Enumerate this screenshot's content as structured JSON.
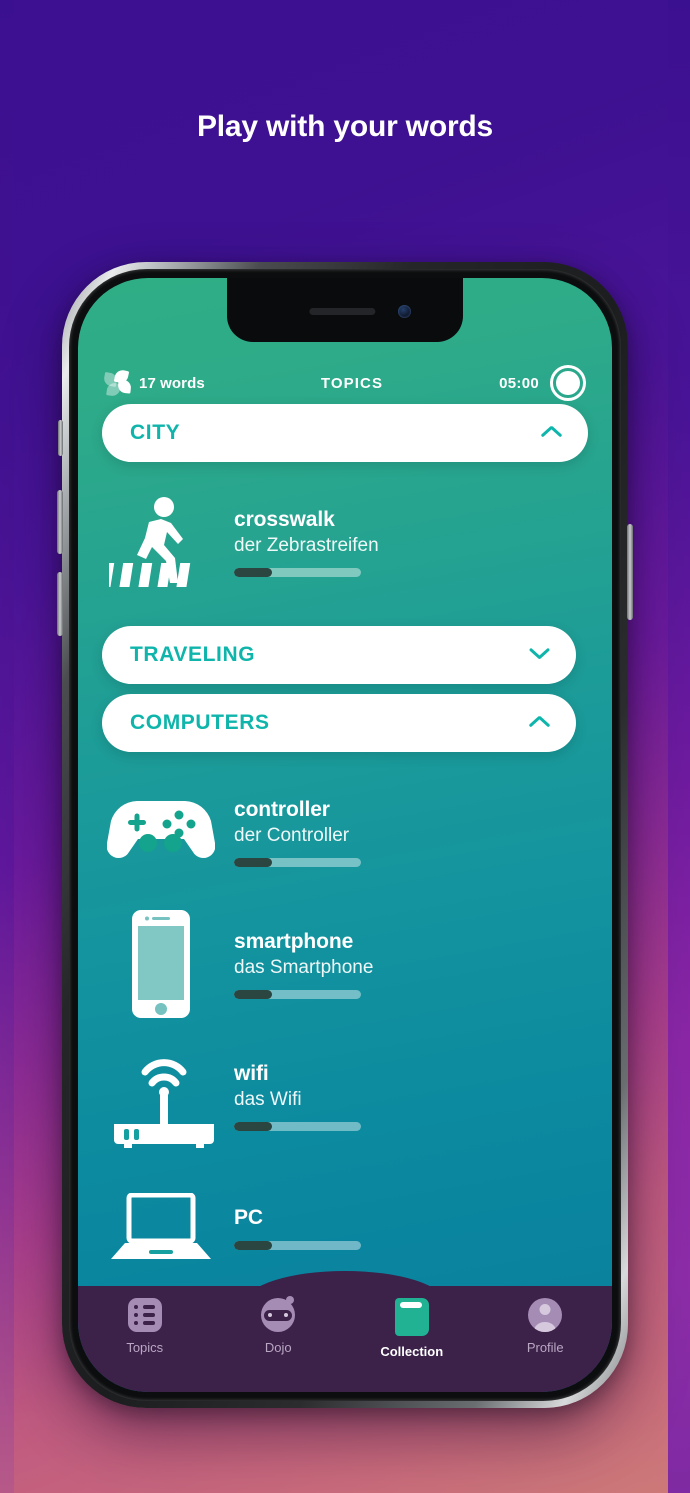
{
  "headline": "Play with your words",
  "statusbar": {
    "words_icon": "clover-petal-icon",
    "words_count": "17 words",
    "title": "TOPICS",
    "timer": "05:00",
    "record_icon": "record-circle-icon"
  },
  "colors": {
    "accent_teal": "#0fb5ab",
    "pill_white": "#ffffff",
    "tabbar_purple": "#3c2149",
    "book_green": "#20b293",
    "progress_fill": "#2b4540",
    "bg_purple": "#3c1090",
    "bg_rose": "#cc7a78"
  },
  "list": [
    {
      "type": "topic",
      "label": "CITY",
      "expanded": true,
      "chevron": "chevron-up-icon"
    },
    {
      "type": "word",
      "icon": "crosswalk-icon",
      "en": "crosswalk",
      "de": "der Zebrastreifen",
      "progress": 30
    },
    {
      "type": "topic",
      "label": "TRAVELING",
      "expanded": false,
      "chevron": "chevron-down-icon"
    },
    {
      "type": "topic",
      "label": "COMPUTERS",
      "expanded": true,
      "chevron": "chevron-up-icon"
    },
    {
      "type": "word",
      "icon": "gamepad-icon",
      "en": "controller",
      "de": "der Controller",
      "progress": 30
    },
    {
      "type": "word",
      "icon": "smartphone-icon",
      "en": "smartphone",
      "de": "das Smartphone",
      "progress": 30
    },
    {
      "type": "word",
      "icon": "wifi-router-icon",
      "en": "wifi",
      "de": "das Wifi",
      "progress": 30
    },
    {
      "type": "word",
      "icon": "laptop-icon",
      "en": "PC",
      "de": "",
      "progress": 30
    }
  ],
  "tabs": [
    {
      "label": "Topics",
      "icon": "list-icon",
      "active": false
    },
    {
      "label": "Dojo",
      "icon": "ninja-icon",
      "active": false
    },
    {
      "label": "Collection",
      "icon": "book-icon",
      "active": true
    },
    {
      "label": "Profile",
      "icon": "person-icon",
      "active": false
    }
  ]
}
